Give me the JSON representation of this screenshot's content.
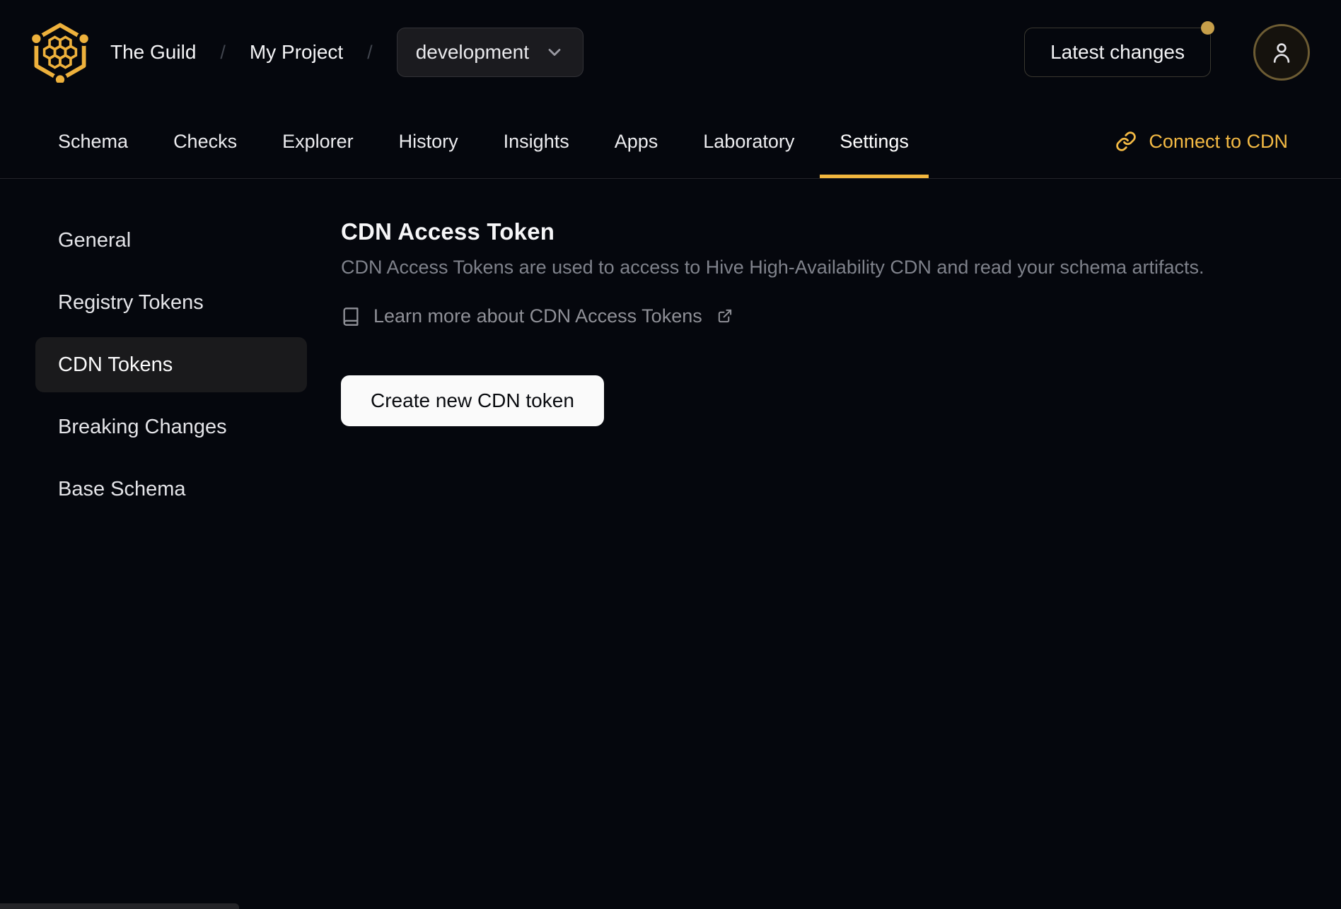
{
  "colors": {
    "background": "#05070d",
    "gold": "#f2b63e",
    "notification_dot": "#c79f4a",
    "panel": "#1b1b1f",
    "active_item_bg": "#1a1a1c",
    "primary_button_bg": "#fafafa"
  },
  "header": {
    "org_name": "The Guild",
    "project_name": "My Project",
    "breadcrumb_separator": "/",
    "target_select": {
      "value": "development"
    },
    "latest_changes_button": "Latest changes"
  },
  "tabs": {
    "items": [
      {
        "label": "Schema",
        "active": false
      },
      {
        "label": "Checks",
        "active": false
      },
      {
        "label": "Explorer",
        "active": false
      },
      {
        "label": "History",
        "active": false
      },
      {
        "label": "Insights",
        "active": false
      },
      {
        "label": "Apps",
        "active": false
      },
      {
        "label": "Laboratory",
        "active": false
      },
      {
        "label": "Settings",
        "active": true
      }
    ],
    "connect_to_cdn": "Connect to CDN"
  },
  "sidebar": {
    "items": [
      {
        "label": "General",
        "active": false
      },
      {
        "label": "Registry Tokens",
        "active": false
      },
      {
        "label": "CDN Tokens",
        "active": true
      },
      {
        "label": "Breaking Changes",
        "active": false
      },
      {
        "label": "Base Schema",
        "active": false
      }
    ]
  },
  "main": {
    "title": "CDN Access Token",
    "description": "CDN Access Tokens are used to access to Hive High-Availability CDN and read your schema artifacts.",
    "learn_more_link": "Learn more about CDN Access Tokens",
    "create_token_button": "Create new CDN token"
  },
  "icons": {
    "logo": "hive-honeycomb-logo",
    "target_chevron": "chevron-down-icon",
    "connect": "link-icon",
    "learn_more": "book-icon",
    "external": "external-link-icon",
    "avatar": "user-icon"
  }
}
